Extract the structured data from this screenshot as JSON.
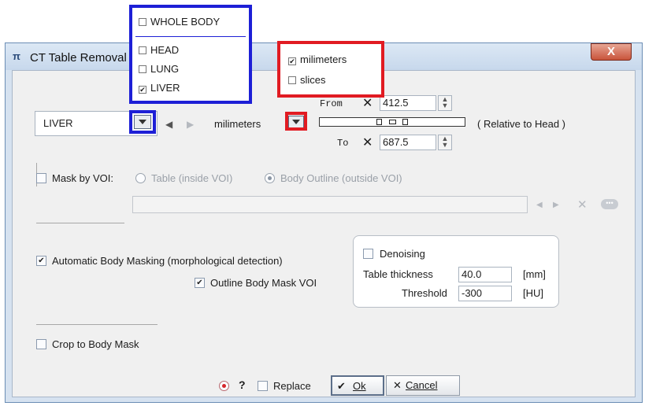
{
  "window": {
    "title": "CT Table Removal",
    "close_label": "X"
  },
  "body_part": {
    "selected": "LIVER",
    "options": [
      {
        "label": "WHOLE BODY",
        "checked": false
      },
      {
        "label": "HEAD",
        "checked": false
      },
      {
        "label": "LUNG",
        "checked": false
      },
      {
        "label": "LIVER",
        "checked": true
      }
    ]
  },
  "units": {
    "selected": "milimeters",
    "options": [
      {
        "label": "milimeters",
        "checked": true
      },
      {
        "label": "slices",
        "checked": false
      }
    ]
  },
  "range": {
    "from_label": "From",
    "from_value": "412.5",
    "to_label": "To",
    "to_value": "687.5",
    "relative_label": "( Relative to Head )"
  },
  "mask_voi": {
    "label": "Mask by VOI:",
    "checked": false,
    "option_table": "Table (inside VOI)",
    "option_body": "Body Outline (outside VOI)",
    "selected": "Body Outline (outside VOI)",
    "voi_value": ""
  },
  "auto_mask": {
    "label": "Automatic Body Masking (morphological detection)",
    "checked": true,
    "outline_label": "Outline Body Mask VOI",
    "outline_checked": true
  },
  "denoise": {
    "label": "Denoising",
    "checked": false,
    "table_thickness_label": "Table thickness",
    "table_thickness_value": "40.0",
    "table_thickness_unit": "[mm]",
    "threshold_label": "Threshold",
    "threshold_value": "-300",
    "threshold_unit": "[HU]"
  },
  "crop": {
    "label": "Crop to Body Mask",
    "checked": false
  },
  "footer": {
    "help_label": "?",
    "replace_label": "Replace",
    "replace_checked": false,
    "ok_label": "Ok",
    "cancel_label": "Cancel"
  },
  "colors": {
    "highlight_blue": "#1d1fd6",
    "highlight_red": "#e11b22"
  }
}
